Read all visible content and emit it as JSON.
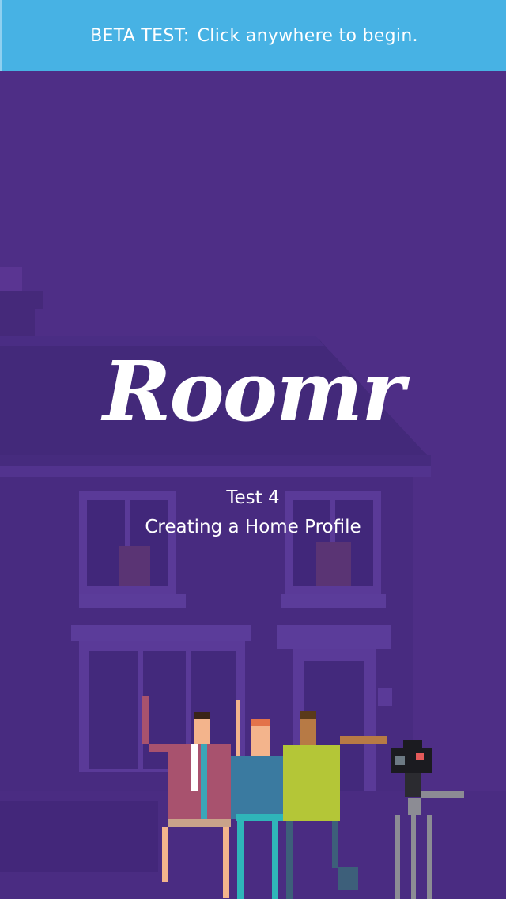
{
  "banner": {
    "label": "BETA TEST:",
    "message": "Click anywhere to begin."
  },
  "app": {
    "logo_text": "Roomr"
  },
  "test": {
    "title": "Test 4",
    "subtitle": "Creating a Home Profile"
  },
  "colors": {
    "banner_bg": "#47b2e4",
    "background": "#4e2e86",
    "text": "#ffffff"
  }
}
